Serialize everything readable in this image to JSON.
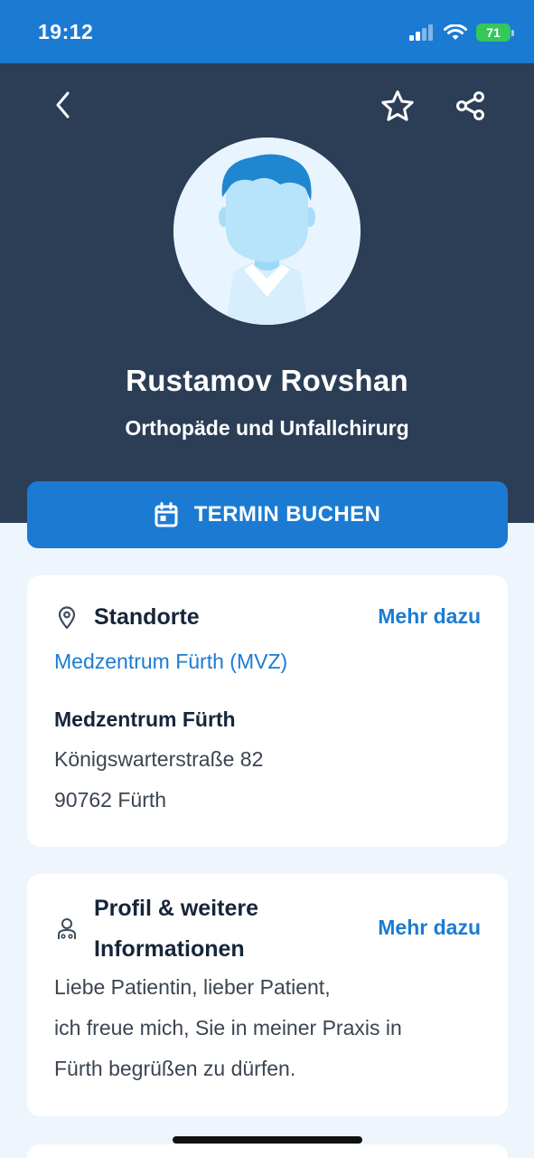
{
  "status_bar": {
    "time": "19:12",
    "battery": "71"
  },
  "header": {
    "back_icon": "chevron-left-icon",
    "favorite_icon": "star-icon",
    "share_icon": "share-icon"
  },
  "doctor": {
    "name": "Rustamov Rovshan",
    "specialty": "Orthopäde und Unfallchirurg"
  },
  "booking": {
    "label": "TERMIN BUCHEN",
    "icon": "calendar-icon"
  },
  "locations": {
    "title": "Standorte",
    "more_label": "Mehr dazu",
    "icon": "location-pin-icon",
    "link": "Medzentrum Fürth (MVZ)",
    "name": "Medzentrum Fürth",
    "street": "Königswarterstraße 82",
    "city": "90762 Fürth"
  },
  "profile": {
    "title_line1": "Profil & weitere",
    "title_line2": "Informationen",
    "more_label": "Mehr dazu",
    "icon": "doctor-icon",
    "text_line1": "Liebe Patientin, lieber Patient,",
    "text_line2": "ich freue mich, Sie in meiner Praxis in",
    "text_line3": "Fürth begrüßen zu dürfen."
  },
  "colors": {
    "primary": "#1b7bd3",
    "hero": "#2b3e56",
    "background": "#eef5fc"
  }
}
